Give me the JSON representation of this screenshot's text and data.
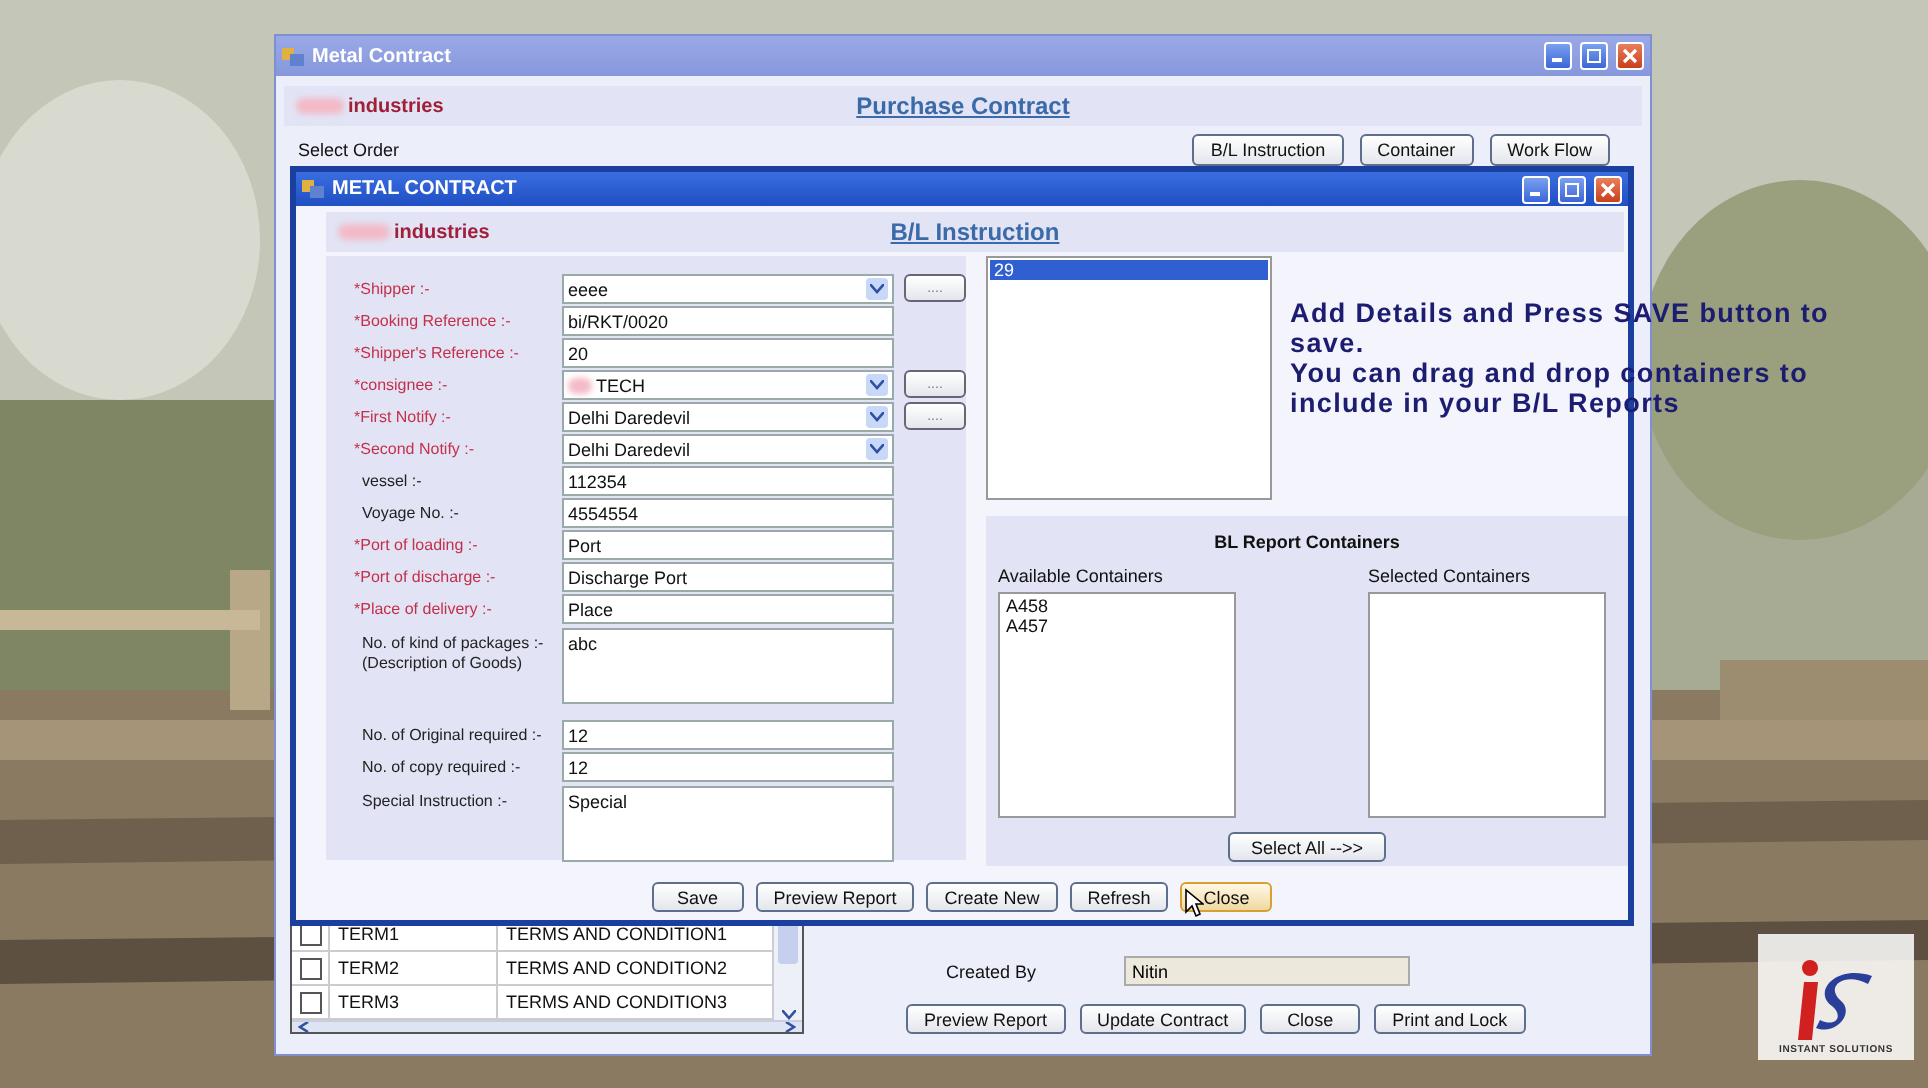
{
  "background": {
    "kind": "picture"
  },
  "main_window": {
    "title": "Metal Contract",
    "company": "industries",
    "heading": "Purchase Contract",
    "select_order_label": "Select Order",
    "top_buttons": [
      "B/L Instruction",
      "Container",
      "Work Flow"
    ],
    "terms": [
      {
        "checked": false,
        "code": "TERM1",
        "text": "TERMS AND CONDITION1"
      },
      {
        "checked": false,
        "code": "TERM2",
        "text": "TERMS AND CONDITION2"
      },
      {
        "checked": false,
        "code": "TERM3",
        "text": "TERMS AND CONDITION3"
      }
    ],
    "created_by_label": "Created By",
    "created_by_value": "Nitin",
    "bottom_buttons": [
      "Preview Report",
      "Update Contract",
      "Close",
      "Print and Lock"
    ]
  },
  "dialog": {
    "title": "METAL CONTRACT",
    "company": "industries",
    "heading": "B/L Instruction",
    "fields": [
      {
        "label": "*Shipper :-",
        "kind": "combo",
        "value": "eeee",
        "required": true,
        "browse": "...."
      },
      {
        "label": "*Booking Reference :-",
        "kind": "text",
        "value": "bi/RKT/0020",
        "required": true
      },
      {
        "label": "*Shipper's Reference :-",
        "kind": "text",
        "value": "20",
        "required": true
      },
      {
        "label": "*consignee :-",
        "kind": "combo",
        "value": "TECH",
        "required": true,
        "browse": "....",
        "blurred_prefix": true
      },
      {
        "label": "*First Notify :-",
        "kind": "combo",
        "value": "Delhi Daredevil",
        "required": true,
        "browse": "...."
      },
      {
        "label": "*Second Notify :-",
        "kind": "combo",
        "value": "Delhi Daredevil",
        "required": true
      },
      {
        "label": "vessel :-",
        "kind": "text",
        "value": "112354",
        "required": false
      },
      {
        "label": "Voyage No. :-",
        "kind": "text",
        "value": "4554554",
        "required": false
      },
      {
        "label": "*Port of loading :-",
        "kind": "text",
        "value": "Port",
        "required": true
      },
      {
        "label": "*Port of discharge :-",
        "kind": "text",
        "value": "Discharge Port",
        "required": true
      },
      {
        "label": "*Place of delivery :-",
        "kind": "text",
        "value": "Place",
        "required": true
      },
      {
        "label": "No. of kind of packages :- (Description of Goods)",
        "kind": "area",
        "value": "abc",
        "required": false
      },
      {
        "label": "No. of  Original required :-",
        "kind": "text",
        "value": "12",
        "required": false
      },
      {
        "label": "No. of copy required :-",
        "kind": "text",
        "value": "12",
        "required": false
      },
      {
        "label": "Special Instruction :-",
        "kind": "area",
        "value": "Special",
        "required": false
      }
    ],
    "notes_list": [
      {
        "text": "29",
        "selected": true
      }
    ],
    "containers": {
      "title": "BL Report Containers",
      "available_label": "Available Containers",
      "available": [
        "A458",
        "A457"
      ],
      "selected_label": "Selected Containers",
      "select_all": "Select All -->>"
    },
    "buttons": [
      {
        "label": "Save",
        "hover": false
      },
      {
        "label": "Preview Report",
        "hover": false
      },
      {
        "label": "Create New",
        "hover": false
      },
      {
        "label": "Refresh",
        "hover": false
      },
      {
        "label": "Close",
        "hover": true
      }
    ]
  },
  "overlay_note": [
    "Add Details and Press SAVE button to save.",
    "You can drag and drop containers to include in your B/L Reports"
  ],
  "logo": {
    "text": "INSTANT SOLUTIONS"
  }
}
